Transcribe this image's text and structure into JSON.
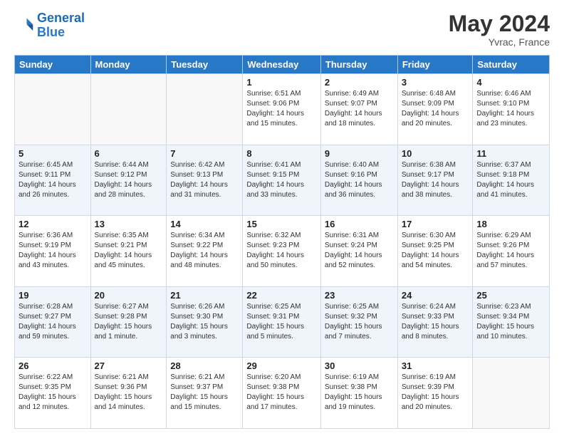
{
  "header": {
    "logo_line1": "General",
    "logo_line2": "Blue",
    "month": "May 2024",
    "location": "Yvrac, France"
  },
  "weekdays": [
    "Sunday",
    "Monday",
    "Tuesday",
    "Wednesday",
    "Thursday",
    "Friday",
    "Saturday"
  ],
  "weeks": [
    [
      {
        "day": "",
        "sunrise": "",
        "sunset": "",
        "daylight": ""
      },
      {
        "day": "",
        "sunrise": "",
        "sunset": "",
        "daylight": ""
      },
      {
        "day": "",
        "sunrise": "",
        "sunset": "",
        "daylight": ""
      },
      {
        "day": "1",
        "sunrise": "Sunrise: 6:51 AM",
        "sunset": "Sunset: 9:06 PM",
        "daylight": "Daylight: 14 hours and 15 minutes."
      },
      {
        "day": "2",
        "sunrise": "Sunrise: 6:49 AM",
        "sunset": "Sunset: 9:07 PM",
        "daylight": "Daylight: 14 hours and 18 minutes."
      },
      {
        "day": "3",
        "sunrise": "Sunrise: 6:48 AM",
        "sunset": "Sunset: 9:09 PM",
        "daylight": "Daylight: 14 hours and 20 minutes."
      },
      {
        "day": "4",
        "sunrise": "Sunrise: 6:46 AM",
        "sunset": "Sunset: 9:10 PM",
        "daylight": "Daylight: 14 hours and 23 minutes."
      }
    ],
    [
      {
        "day": "5",
        "sunrise": "Sunrise: 6:45 AM",
        "sunset": "Sunset: 9:11 PM",
        "daylight": "Daylight: 14 hours and 26 minutes."
      },
      {
        "day": "6",
        "sunrise": "Sunrise: 6:44 AM",
        "sunset": "Sunset: 9:12 PM",
        "daylight": "Daylight: 14 hours and 28 minutes."
      },
      {
        "day": "7",
        "sunrise": "Sunrise: 6:42 AM",
        "sunset": "Sunset: 9:13 PM",
        "daylight": "Daylight: 14 hours and 31 minutes."
      },
      {
        "day": "8",
        "sunrise": "Sunrise: 6:41 AM",
        "sunset": "Sunset: 9:15 PM",
        "daylight": "Daylight: 14 hours and 33 minutes."
      },
      {
        "day": "9",
        "sunrise": "Sunrise: 6:40 AM",
        "sunset": "Sunset: 9:16 PM",
        "daylight": "Daylight: 14 hours and 36 minutes."
      },
      {
        "day": "10",
        "sunrise": "Sunrise: 6:38 AM",
        "sunset": "Sunset: 9:17 PM",
        "daylight": "Daylight: 14 hours and 38 minutes."
      },
      {
        "day": "11",
        "sunrise": "Sunrise: 6:37 AM",
        "sunset": "Sunset: 9:18 PM",
        "daylight": "Daylight: 14 hours and 41 minutes."
      }
    ],
    [
      {
        "day": "12",
        "sunrise": "Sunrise: 6:36 AM",
        "sunset": "Sunset: 9:19 PM",
        "daylight": "Daylight: 14 hours and 43 minutes."
      },
      {
        "day": "13",
        "sunrise": "Sunrise: 6:35 AM",
        "sunset": "Sunset: 9:21 PM",
        "daylight": "Daylight: 14 hours and 45 minutes."
      },
      {
        "day": "14",
        "sunrise": "Sunrise: 6:34 AM",
        "sunset": "Sunset: 9:22 PM",
        "daylight": "Daylight: 14 hours and 48 minutes."
      },
      {
        "day": "15",
        "sunrise": "Sunrise: 6:32 AM",
        "sunset": "Sunset: 9:23 PM",
        "daylight": "Daylight: 14 hours and 50 minutes."
      },
      {
        "day": "16",
        "sunrise": "Sunrise: 6:31 AM",
        "sunset": "Sunset: 9:24 PM",
        "daylight": "Daylight: 14 hours and 52 minutes."
      },
      {
        "day": "17",
        "sunrise": "Sunrise: 6:30 AM",
        "sunset": "Sunset: 9:25 PM",
        "daylight": "Daylight: 14 hours and 54 minutes."
      },
      {
        "day": "18",
        "sunrise": "Sunrise: 6:29 AM",
        "sunset": "Sunset: 9:26 PM",
        "daylight": "Daylight: 14 hours and 57 minutes."
      }
    ],
    [
      {
        "day": "19",
        "sunrise": "Sunrise: 6:28 AM",
        "sunset": "Sunset: 9:27 PM",
        "daylight": "Daylight: 14 hours and 59 minutes."
      },
      {
        "day": "20",
        "sunrise": "Sunrise: 6:27 AM",
        "sunset": "Sunset: 9:28 PM",
        "daylight": "Daylight: 15 hours and 1 minute."
      },
      {
        "day": "21",
        "sunrise": "Sunrise: 6:26 AM",
        "sunset": "Sunset: 9:30 PM",
        "daylight": "Daylight: 15 hours and 3 minutes."
      },
      {
        "day": "22",
        "sunrise": "Sunrise: 6:25 AM",
        "sunset": "Sunset: 9:31 PM",
        "daylight": "Daylight: 15 hours and 5 minutes."
      },
      {
        "day": "23",
        "sunrise": "Sunrise: 6:25 AM",
        "sunset": "Sunset: 9:32 PM",
        "daylight": "Daylight: 15 hours and 7 minutes."
      },
      {
        "day": "24",
        "sunrise": "Sunrise: 6:24 AM",
        "sunset": "Sunset: 9:33 PM",
        "daylight": "Daylight: 15 hours and 8 minutes."
      },
      {
        "day": "25",
        "sunrise": "Sunrise: 6:23 AM",
        "sunset": "Sunset: 9:34 PM",
        "daylight": "Daylight: 15 hours and 10 minutes."
      }
    ],
    [
      {
        "day": "26",
        "sunrise": "Sunrise: 6:22 AM",
        "sunset": "Sunset: 9:35 PM",
        "daylight": "Daylight: 15 hours and 12 minutes."
      },
      {
        "day": "27",
        "sunrise": "Sunrise: 6:21 AM",
        "sunset": "Sunset: 9:36 PM",
        "daylight": "Daylight: 15 hours and 14 minutes."
      },
      {
        "day": "28",
        "sunrise": "Sunrise: 6:21 AM",
        "sunset": "Sunset: 9:37 PM",
        "daylight": "Daylight: 15 hours and 15 minutes."
      },
      {
        "day": "29",
        "sunrise": "Sunrise: 6:20 AM",
        "sunset": "Sunset: 9:38 PM",
        "daylight": "Daylight: 15 hours and 17 minutes."
      },
      {
        "day": "30",
        "sunrise": "Sunrise: 6:19 AM",
        "sunset": "Sunset: 9:38 PM",
        "daylight": "Daylight: 15 hours and 19 minutes."
      },
      {
        "day": "31",
        "sunrise": "Sunrise: 6:19 AM",
        "sunset": "Sunset: 9:39 PM",
        "daylight": "Daylight: 15 hours and 20 minutes."
      },
      {
        "day": "",
        "sunrise": "",
        "sunset": "",
        "daylight": ""
      }
    ]
  ]
}
